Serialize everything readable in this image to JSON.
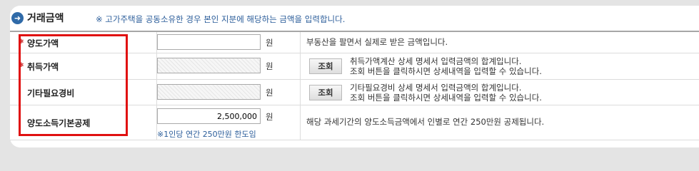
{
  "section": {
    "title": "거래금액",
    "note": "※ 고가주택을 공동소유한 경우 본인 지분에 해당하는 금액을 입력합니다."
  },
  "rows": [
    {
      "label": "양도가액",
      "required": true,
      "value": "",
      "unit": "원",
      "description": "부동산을 팔면서 실제로 받은 금액입니다."
    },
    {
      "label": "취득가액",
      "required": true,
      "value": "",
      "unit": "원",
      "button": "조회",
      "description_line1": "취득가액계산 상세 명세서 입력금액의 합계입니다.",
      "description_line2": "조회 버튼을 클릭하시면 상세내역을 입력할 수 있습니다."
    },
    {
      "label": "기타필요경비",
      "required": false,
      "value": "",
      "unit": "원",
      "button": "조회",
      "description_line1": "기타필요경비 상세 명세서 입력금액의 합계입니다.",
      "description_line2": "조회 버튼을 클릭하시면 상세내역을 입력할 수 있습니다."
    },
    {
      "label": "양도소득기본공제",
      "required": false,
      "value": "2,500,000",
      "unit": "원",
      "hint": "※1인당 연간 250만원 한도임",
      "description": "해당 과세기간의 양도소득금액에서 인별로 연간 250만원 공제됩니다."
    }
  ],
  "icons": {
    "section_bullet": "arrow-right-icon",
    "required_mark": "asterisk-icon"
  },
  "colors": {
    "accent": "#2b5d9a",
    "highlight": "#e01010"
  }
}
